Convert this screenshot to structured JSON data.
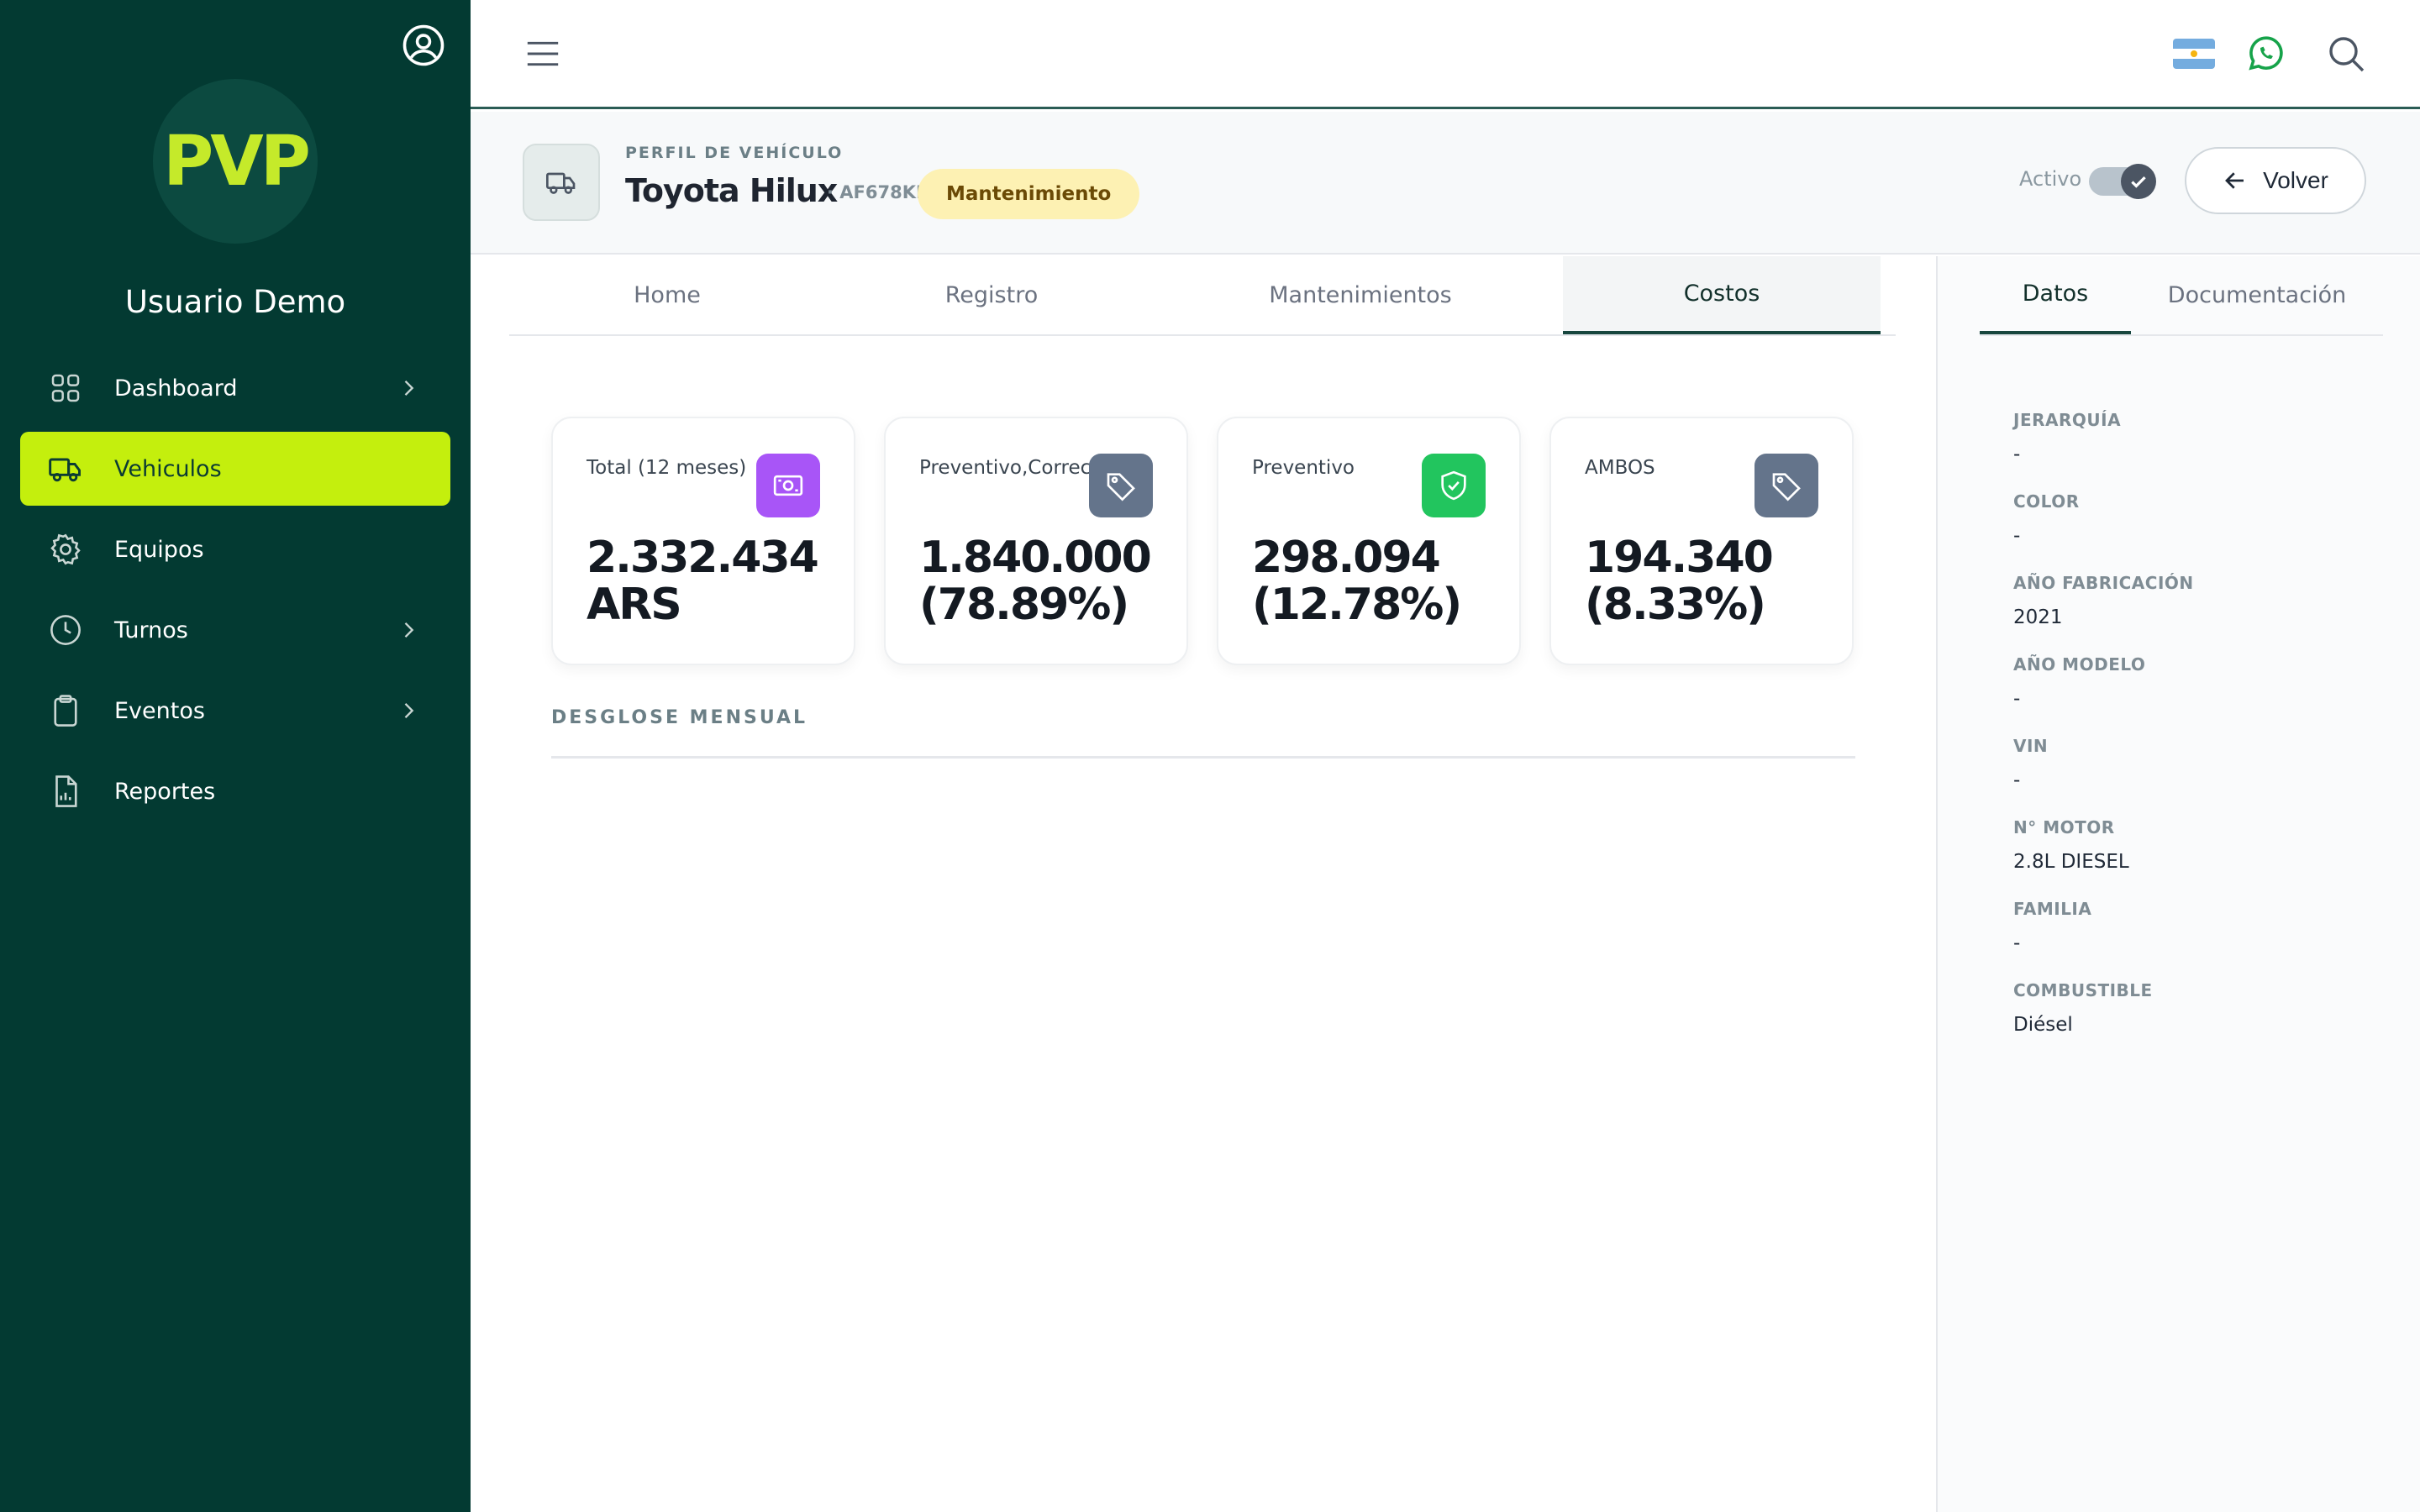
{
  "sidebar": {
    "user_name": "Usuario Demo",
    "logo_text": "PVP",
    "items": [
      {
        "label": "Dashboard",
        "icon": "grid-icon",
        "has_chevron": true
      },
      {
        "label": "Vehiculos",
        "icon": "truck-icon",
        "active": true
      },
      {
        "label": "Equipos",
        "icon": "gear-icon"
      },
      {
        "label": "Turnos",
        "icon": "clock-icon",
        "has_chevron": true
      },
      {
        "label": "Eventos",
        "icon": "clipboard-icon",
        "has_chevron": true
      },
      {
        "label": "Reportes",
        "icon": "report-icon"
      }
    ]
  },
  "topbar": {
    "icons": [
      "menu-icon",
      "argentina-flag-icon",
      "whatsapp-icon",
      "search-icon"
    ]
  },
  "vehicle": {
    "eyebrow": "PERFIL DE VEHÍCULO",
    "name": "Toyota Hilux",
    "plate": "· AF678KL",
    "status": "Mantenimiento",
    "active_label": "Activo",
    "active": true,
    "back_label": "Volver"
  },
  "tabs": [
    {
      "label": "Home"
    },
    {
      "label": "Registro"
    },
    {
      "label": "Mantenimientos"
    },
    {
      "label": "Costos",
      "active": true
    }
  ],
  "kpis": [
    {
      "label": "Total (12 meses)",
      "value_line1": "2.332.434",
      "value_line2": "ARS",
      "icon": "money-icon",
      "icon_color": "#a855f7"
    },
    {
      "label": "Preventivo,Correctivo",
      "value_line1": "1.840.000",
      "value_line2": "(78.89%)",
      "icon": "tag-icon",
      "icon_color": "#64748b"
    },
    {
      "label": "Preventivo",
      "value_line1": "298.094",
      "value_line2": "(12.78%)",
      "icon": "shield-check-icon",
      "icon_color": "#22c55e"
    },
    {
      "label": "AMBOS",
      "value_line1": "194.340",
      "value_line2": "(8.33%)",
      "icon": "tag-icon",
      "icon_color": "#64748b"
    }
  ],
  "breakdown_title": "DESGLOSE MENSUAL",
  "right_panel": {
    "tabs": [
      {
        "label": "Datos",
        "active": true
      },
      {
        "label": "Documentación"
      }
    ],
    "fields": [
      {
        "label": "JERARQUÍA",
        "value": "-"
      },
      {
        "label": "COLOR",
        "value": "-"
      },
      {
        "label": "AÑO FABRICACIÓN",
        "value": "2021"
      },
      {
        "label": "AÑO MODELO",
        "value": "-"
      },
      {
        "label": "VIN",
        "value": "-"
      },
      {
        "label": "N° MOTOR",
        "value": "2.8L DIESEL"
      },
      {
        "label": "FAMILIA",
        "value": "-"
      },
      {
        "label": "COMBUSTIBLE",
        "value": "Diésel"
      }
    ]
  },
  "colors": {
    "sidebar_bg": "#033a32",
    "accent": "#c4ef0d",
    "status_badge_bg": "#fdf1b3"
  }
}
